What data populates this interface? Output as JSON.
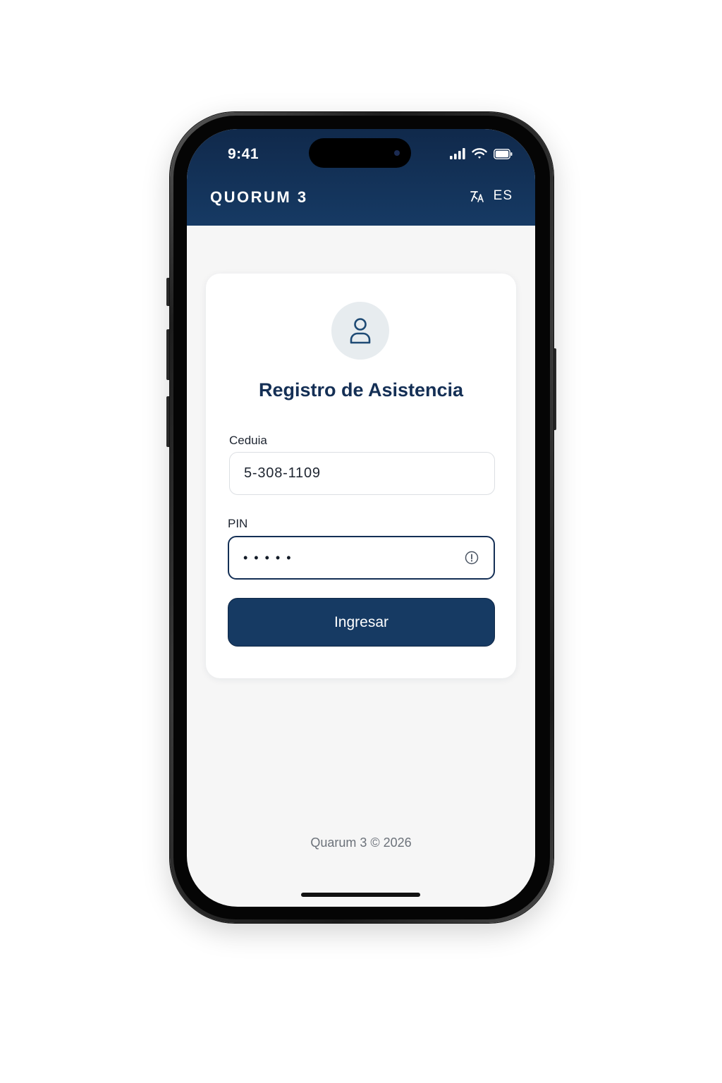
{
  "status_bar": {
    "time": "9:41",
    "icons": [
      "signal-icon",
      "wifi-icon",
      "battery-icon"
    ]
  },
  "header": {
    "title": "QUORUM 3",
    "language_label": "ES",
    "language_icon": "translate-icon"
  },
  "login": {
    "avatar_icon": "user-icon",
    "title": "Registro de Asistencia",
    "cedula": {
      "label": "Ceduia",
      "value": "5-308-1109"
    },
    "pin": {
      "label": "PIN",
      "masked_value": "•••••",
      "toggle_icon": "eye-toggle-icon"
    },
    "submit_label": "Ingresar"
  },
  "footer": {
    "text": "Quarum 3 © 2026"
  },
  "colors": {
    "header_bg": "#163a64",
    "primary": "#142f55",
    "screen_bg": "#f6f6f6",
    "card_bg": "#ffffff"
  }
}
